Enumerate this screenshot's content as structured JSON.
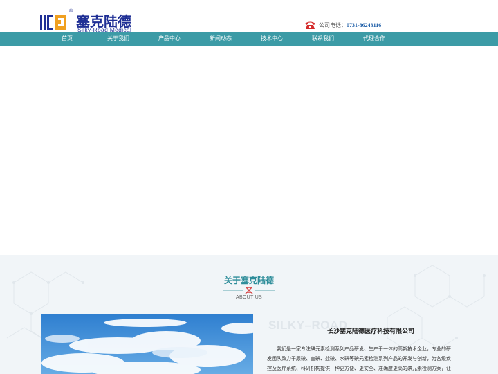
{
  "header": {
    "logo_cn": "塞克陆德",
    "logo_en": "Silky-Road Medical",
    "logo_reg": "®",
    "phone_label": "公司电话：",
    "phone_number": "0731-86243116"
  },
  "nav": {
    "items": [
      "首页",
      "关于我们",
      "产品中心",
      "新闻动态",
      "技术中心",
      "联系我们",
      "代理合作"
    ]
  },
  "about": {
    "title": "关于塞克陆德",
    "subtitle": "ABOUT US",
    "watermark": "SILKY–ROAD",
    "company": "长沙塞克陆德医疗科技有限公司",
    "text": "我们是一家专注碘元素检测系列产品研发、生产于一体的高新技术企业，专业的研发团队致力于尿碘、血碘、盐碘、水碘等碘元素检测系列产品的开发与创新，为各级疾控及医疗系统、科研机构提供一种更方便、更安全、准确度更高的碘元素检测方案，让优"
  },
  "colors": {
    "nav_bg": "#3c9ba6",
    "accent": "#2e8d9a",
    "brand_blue": "#1f2f95",
    "brand_orange": "#f0a020"
  },
  "icons": {
    "phone": "telephone-icon",
    "divider": "dna-icon"
  }
}
